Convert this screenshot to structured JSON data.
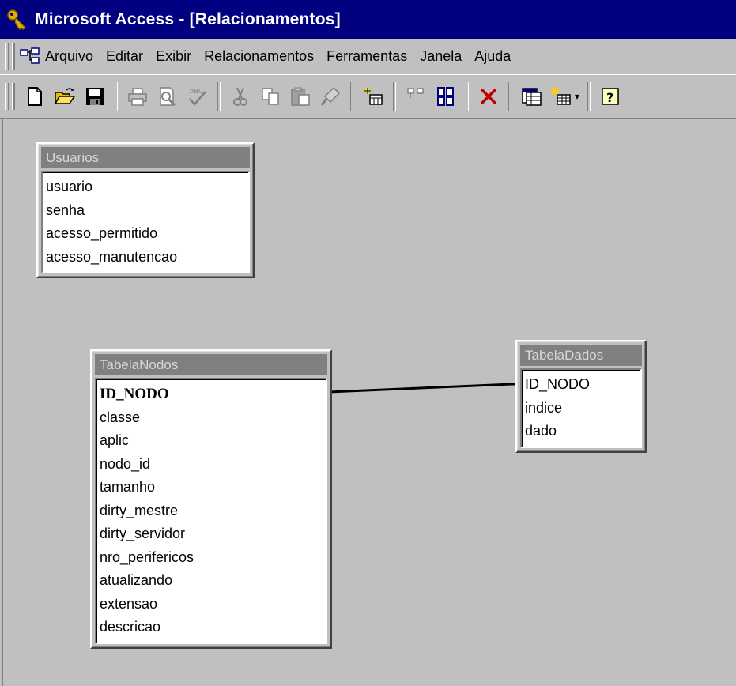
{
  "window": {
    "title": "Microsoft Access - [Relacionamentos]"
  },
  "menu": {
    "items": [
      {
        "label": "Arquivo"
      },
      {
        "label": "Editar"
      },
      {
        "label": "Exibir"
      },
      {
        "label": "Relacionamentos"
      },
      {
        "label": "Ferramentas"
      },
      {
        "label": "Janela"
      },
      {
        "label": "Ajuda"
      }
    ]
  },
  "toolbar": {
    "icons": [
      "new-icon",
      "open-icon",
      "save-icon",
      "print-icon",
      "print-preview-icon",
      "spelling-icon",
      "cut-icon",
      "copy-icon",
      "paste-icon",
      "format-painter-icon",
      "show-table-icon",
      "show-direct-icon",
      "show-all-icon",
      "delete-icon",
      "database-window-icon",
      "new-object-icon",
      "help-icon"
    ]
  },
  "tables": {
    "usuarios": {
      "name": "Usuarios",
      "fields": [
        "usuario",
        "senha",
        "acesso_permitido",
        "acesso_manutencao"
      ]
    },
    "tabela_nodos": {
      "name": "TabelaNodos",
      "fields": [
        "ID_NODO",
        "classe",
        "aplic",
        "nodo_id",
        "tamanho",
        "dirty_mestre",
        "dirty_servidor",
        "nro_perifericos",
        "atualizando",
        "extensao",
        "descricao"
      ]
    },
    "tabela_dados": {
      "name": "TabelaDados",
      "fields": [
        "ID_NODO",
        "indice",
        "dado"
      ]
    }
  },
  "colors": {
    "title_bar": "#000080",
    "workspace": "#c0c0c0",
    "table_caption_inactive": "#808080"
  }
}
